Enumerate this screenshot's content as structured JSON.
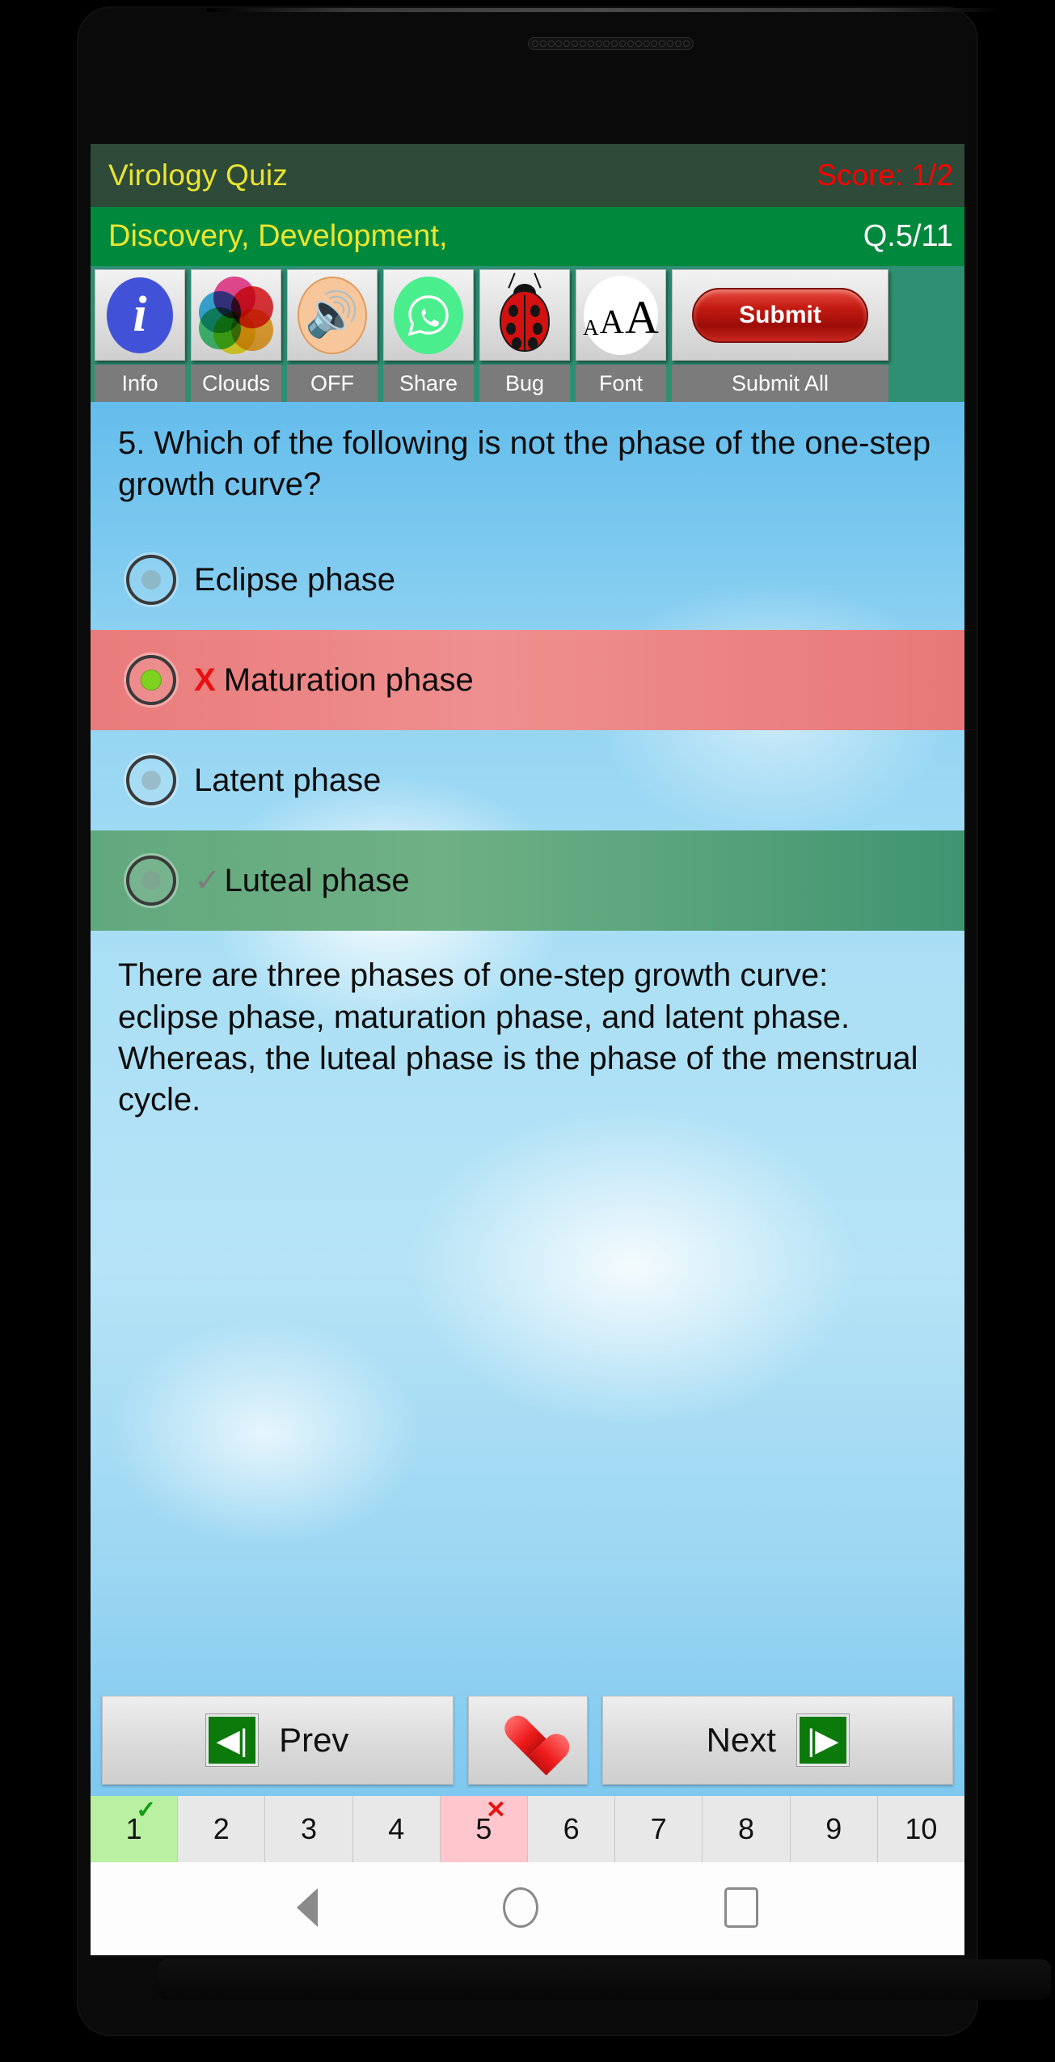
{
  "app": {
    "title": "Virology Quiz",
    "score": "Score: 1/2",
    "subject": "Discovery, Development,",
    "question_counter": "Q.5/11"
  },
  "toolbar": {
    "items": [
      {
        "label": "Info",
        "icon": "info-icon"
      },
      {
        "label": "Clouds",
        "icon": "clouds-icon"
      },
      {
        "label": "OFF",
        "icon": "speaker-icon"
      },
      {
        "label": "Share",
        "icon": "share-whatsapp-icon"
      },
      {
        "label": "Bug",
        "icon": "bug-icon"
      },
      {
        "label": "Font",
        "icon": "font-size-icon"
      }
    ],
    "submit_button": "Submit",
    "submit_all_label": "Submit All"
  },
  "question": {
    "text": "5. Which of the following is not the phase of the one-step growth curve?",
    "options": [
      {
        "label": "Eclipse phase",
        "state": "neutral",
        "selected": false,
        "mark": ""
      },
      {
        "label": "Maturation phase",
        "state": "incorrect",
        "selected": true,
        "mark": "X"
      },
      {
        "label": "Latent phase",
        "state": "neutral",
        "selected": false,
        "mark": ""
      },
      {
        "label": "Luteal phase",
        "state": "correct",
        "selected": false,
        "mark": "✓"
      }
    ],
    "explanation": "There are three phases of one-step growth curve: eclipse phase, maturation phase, and latent phase. Whereas, the luteal phase is the phase of the menstrual cycle."
  },
  "navigation": {
    "prev_label": "Prev",
    "next_label": "Next",
    "favorite_icon": "heart-icon",
    "prev_icon": "skip-previous-icon",
    "next_icon": "skip-next-icon"
  },
  "pager": {
    "pages": [
      {
        "number": "1",
        "state": "correct"
      },
      {
        "number": "2",
        "state": "none"
      },
      {
        "number": "3",
        "state": "none"
      },
      {
        "number": "4",
        "state": "none"
      },
      {
        "number": "5",
        "state": "incorrect"
      },
      {
        "number": "6",
        "state": "none"
      },
      {
        "number": "7",
        "state": "none"
      },
      {
        "number": "8",
        "state": "none"
      },
      {
        "number": "9",
        "state": "none"
      },
      {
        "number": "10",
        "state": "none"
      }
    ],
    "correct_mark": "✓",
    "incorrect_mark": "✕"
  },
  "system_nav": {
    "back": "back-icon",
    "home": "home-icon",
    "recents": "recents-icon"
  },
  "colors": {
    "title_bar": "#2e4a38",
    "subject_bar": "#00883c",
    "title_text": "#e9e431",
    "score_text": "#ff0000",
    "toolbar_bg": "#2e8f73",
    "submit_red": "#c41b13",
    "incorrect_row": "#e97b7b",
    "correct_row": "#62a87e",
    "sky_top": "#64bdec"
  }
}
